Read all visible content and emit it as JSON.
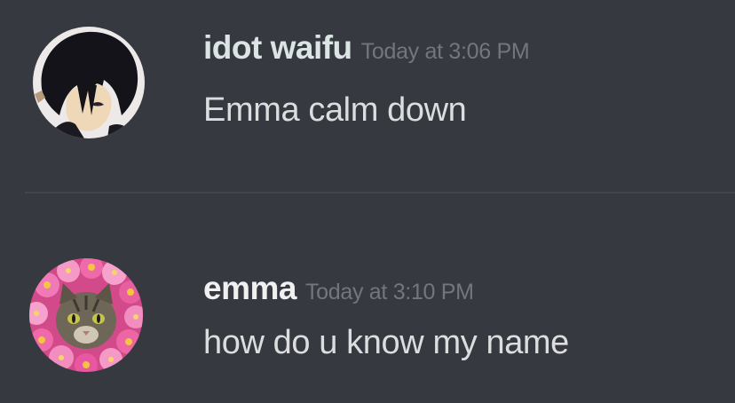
{
  "colors": {
    "background": "#36393f",
    "divider": "#42454a",
    "timestamp": "#72767d",
    "message_text": "#dcddde"
  },
  "messages": [
    {
      "username": "idot waifu",
      "username_color": "#dbe5e3",
      "timestamp": "Today at 3:06 PM",
      "content": "Emma calm down",
      "avatar_icon": "anime-character-avatar"
    },
    {
      "username": "emma",
      "username_color": "#f0f0f0",
      "timestamp": "Today at 3:10 PM",
      "content": "how do u know my name",
      "avatar_icon": "cat-with-flower-crown-avatar"
    }
  ]
}
